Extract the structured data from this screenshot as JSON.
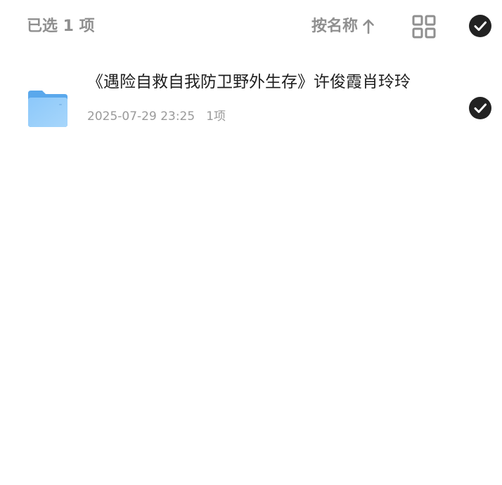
{
  "toolbar": {
    "selected_count": "已选 1 项",
    "sort_label": "按名称",
    "sort_direction_icon": "arrow-up-icon",
    "view_toggle_icon": "grid-view-icon",
    "select_all_icon": "check-circle-icon",
    "select_all_checked": true
  },
  "files": [
    {
      "icon": "folder-icon",
      "name": "《遇险自救自我防卫野外生存》许俊霞肖玲玲",
      "modified": "2025-07-29 23:25",
      "item_count": "1项",
      "selected": true
    }
  ],
  "colors": {
    "muted_text": "#8f8f8f",
    "primary_text": "#1e1e1e",
    "check_fill": "#222222",
    "folder_blue": "#6eb6f4"
  }
}
